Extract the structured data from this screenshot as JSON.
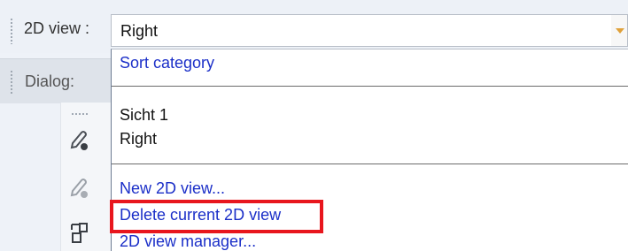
{
  "view_bar": {
    "label": "2D view :",
    "current_value": "Right"
  },
  "dialog_tab": {
    "label": "Dialog:"
  },
  "dropdown": {
    "header_item": "Sort category",
    "views": [
      "Sicht 1",
      "Right"
    ],
    "actions": [
      "New 2D view...",
      "Delete current 2D view",
      "2D view manager..."
    ]
  },
  "icons": {
    "tool_1": "pen-with-filled-dot-icon",
    "tool_2": "pen-with-faded-dot-icon",
    "tool_3": "2d-view-transform-icon",
    "dropdown_arrow": "chevron-down-icon"
  },
  "colors": {
    "link": "#1b2fc8",
    "highlight": "#e8161d",
    "arrow": "#e0a13a"
  }
}
